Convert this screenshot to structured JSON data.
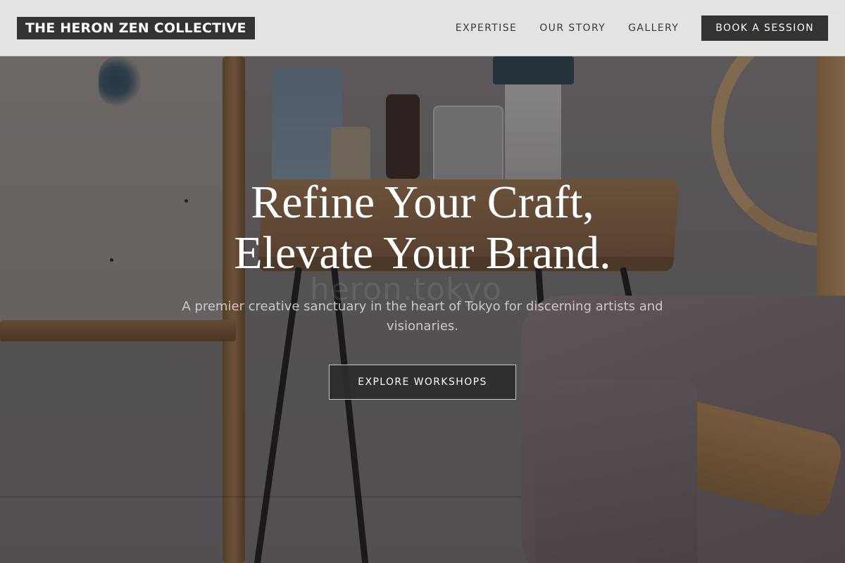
{
  "header": {
    "brand": "THE HERON ZEN COLLECTIVE",
    "nav": [
      {
        "label": "EXPERTISE"
      },
      {
        "label": "OUR STORY"
      },
      {
        "label": "GALLERY"
      }
    ],
    "cta_label": "BOOK A SESSION"
  },
  "hero": {
    "title_line1": "Refine Your Craft,",
    "title_line2": "Elevate Your Brand.",
    "subtitle": "A premier creative sanctuary in the heart of Tokyo for discerning artists and visionaries.",
    "button_label": "EXPLORE WORKSHOPS",
    "watermark": "heron.tokyo"
  },
  "colors": {
    "header_bg": "#eeeeec",
    "brand_bg": "#333334",
    "cta_bg": "#333334",
    "hero_text": "#ffffff"
  }
}
